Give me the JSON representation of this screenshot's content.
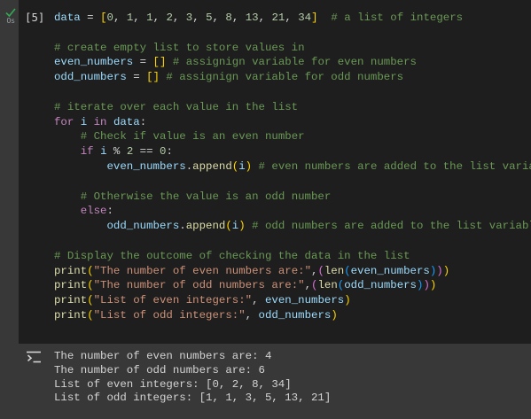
{
  "cell": {
    "execution_count": "[5]",
    "exec_time": "0s",
    "status_icon": "check-icon",
    "lines": [
      [
        [
          "var",
          "data"
        ],
        [
          "op",
          " = "
        ],
        [
          "b1",
          "["
        ],
        [
          "num",
          "0"
        ],
        [
          "op",
          ", "
        ],
        [
          "num",
          "1"
        ],
        [
          "op",
          ", "
        ],
        [
          "num",
          "1"
        ],
        [
          "op",
          ", "
        ],
        [
          "num",
          "2"
        ],
        [
          "op",
          ", "
        ],
        [
          "num",
          "3"
        ],
        [
          "op",
          ", "
        ],
        [
          "num",
          "5"
        ],
        [
          "op",
          ", "
        ],
        [
          "num",
          "8"
        ],
        [
          "op",
          ", "
        ],
        [
          "num",
          "13"
        ],
        [
          "op",
          ", "
        ],
        [
          "num",
          "21"
        ],
        [
          "op",
          ", "
        ],
        [
          "num",
          "34"
        ],
        [
          "b1",
          "]"
        ],
        [
          "op",
          "  "
        ],
        [
          "cm",
          "# a list of integers"
        ]
      ],
      [],
      [
        [
          "cm",
          "# create empty list to store values in"
        ]
      ],
      [
        [
          "var",
          "even_numbers"
        ],
        [
          "op",
          " = "
        ],
        [
          "b1",
          "[]"
        ],
        [
          "op",
          " "
        ],
        [
          "cm",
          "# assignign variable for even numbers"
        ]
      ],
      [
        [
          "var",
          "odd_numbers"
        ],
        [
          "op",
          " = "
        ],
        [
          "b1",
          "[]"
        ],
        [
          "op",
          " "
        ],
        [
          "cm",
          "# assignign variable for odd numbers"
        ]
      ],
      [],
      [
        [
          "cm",
          "# iterate over each value in the list"
        ]
      ],
      [
        [
          "kw",
          "for"
        ],
        [
          "op",
          " "
        ],
        [
          "var",
          "i"
        ],
        [
          "op",
          " "
        ],
        [
          "kw",
          "in"
        ],
        [
          "op",
          " "
        ],
        [
          "var",
          "data"
        ],
        [
          "op",
          ":"
        ]
      ],
      [
        [
          "op",
          "    "
        ],
        [
          "cm",
          "# Check if value is an even number"
        ]
      ],
      [
        [
          "op",
          "    "
        ],
        [
          "kw",
          "if"
        ],
        [
          "op",
          " "
        ],
        [
          "var",
          "i"
        ],
        [
          "op",
          " % "
        ],
        [
          "num",
          "2"
        ],
        [
          "op",
          " == "
        ],
        [
          "num",
          "0"
        ],
        [
          "op",
          ":"
        ]
      ],
      [
        [
          "op",
          "        "
        ],
        [
          "var",
          "even_numbers"
        ],
        [
          "op",
          "."
        ],
        [
          "fn",
          "append"
        ],
        [
          "b1",
          "("
        ],
        [
          "var",
          "i"
        ],
        [
          "b1",
          ")"
        ],
        [
          "op",
          " "
        ],
        [
          "cm",
          "# even numbers are added to the list variable"
        ]
      ],
      [],
      [
        [
          "op",
          "    "
        ],
        [
          "cm",
          "# Otherwise the value is an odd number"
        ]
      ],
      [
        [
          "op",
          "    "
        ],
        [
          "kw",
          "else"
        ],
        [
          "op",
          ":"
        ]
      ],
      [
        [
          "op",
          "        "
        ],
        [
          "var",
          "odd_numbers"
        ],
        [
          "op",
          "."
        ],
        [
          "fn",
          "append"
        ],
        [
          "b1",
          "("
        ],
        [
          "var",
          "i"
        ],
        [
          "b1",
          ")"
        ],
        [
          "op",
          " "
        ],
        [
          "cm",
          "# odd numbers are added to the list variable"
        ]
      ],
      [],
      [
        [
          "cm",
          "# Display the outcome of checking the data in the list"
        ]
      ],
      [
        [
          "fn",
          "print"
        ],
        [
          "b1",
          "("
        ],
        [
          "str",
          "\"The number of even numbers are:\""
        ],
        [
          "op",
          ","
        ],
        [
          "b2",
          "("
        ],
        [
          "fn",
          "len"
        ],
        [
          "b3",
          "("
        ],
        [
          "var",
          "even_numbers"
        ],
        [
          "b3",
          ")"
        ],
        [
          "b2",
          ")"
        ],
        [
          "b1",
          ")"
        ]
      ],
      [
        [
          "fn",
          "print"
        ],
        [
          "b1",
          "("
        ],
        [
          "str",
          "\"The number of odd numbers are:\""
        ],
        [
          "op",
          ","
        ],
        [
          "b2",
          "("
        ],
        [
          "fn",
          "len"
        ],
        [
          "b3",
          "("
        ],
        [
          "var",
          "odd_numbers"
        ],
        [
          "b3",
          ")"
        ],
        [
          "b2",
          ")"
        ],
        [
          "b1",
          ")"
        ]
      ],
      [
        [
          "fn",
          "print"
        ],
        [
          "b1",
          "("
        ],
        [
          "str",
          "\"List of even integers:\""
        ],
        [
          "op",
          ", "
        ],
        [
          "var",
          "even_numbers"
        ],
        [
          "b1",
          ")"
        ]
      ],
      [
        [
          "fn",
          "print"
        ],
        [
          "b1",
          "("
        ],
        [
          "str",
          "\"List of odd integers:\""
        ],
        [
          "op",
          ", "
        ],
        [
          "var",
          "odd_numbers"
        ],
        [
          "b1",
          ")"
        ]
      ]
    ]
  },
  "output": {
    "icon": "output-toggle-icon",
    "lines": [
      "The number of even numbers are: 4",
      "The number of odd numbers are: 6",
      "List of even integers: [0, 2, 8, 34]",
      "List of odd integers: [1, 1, 3, 5, 13, 21]"
    ]
  }
}
